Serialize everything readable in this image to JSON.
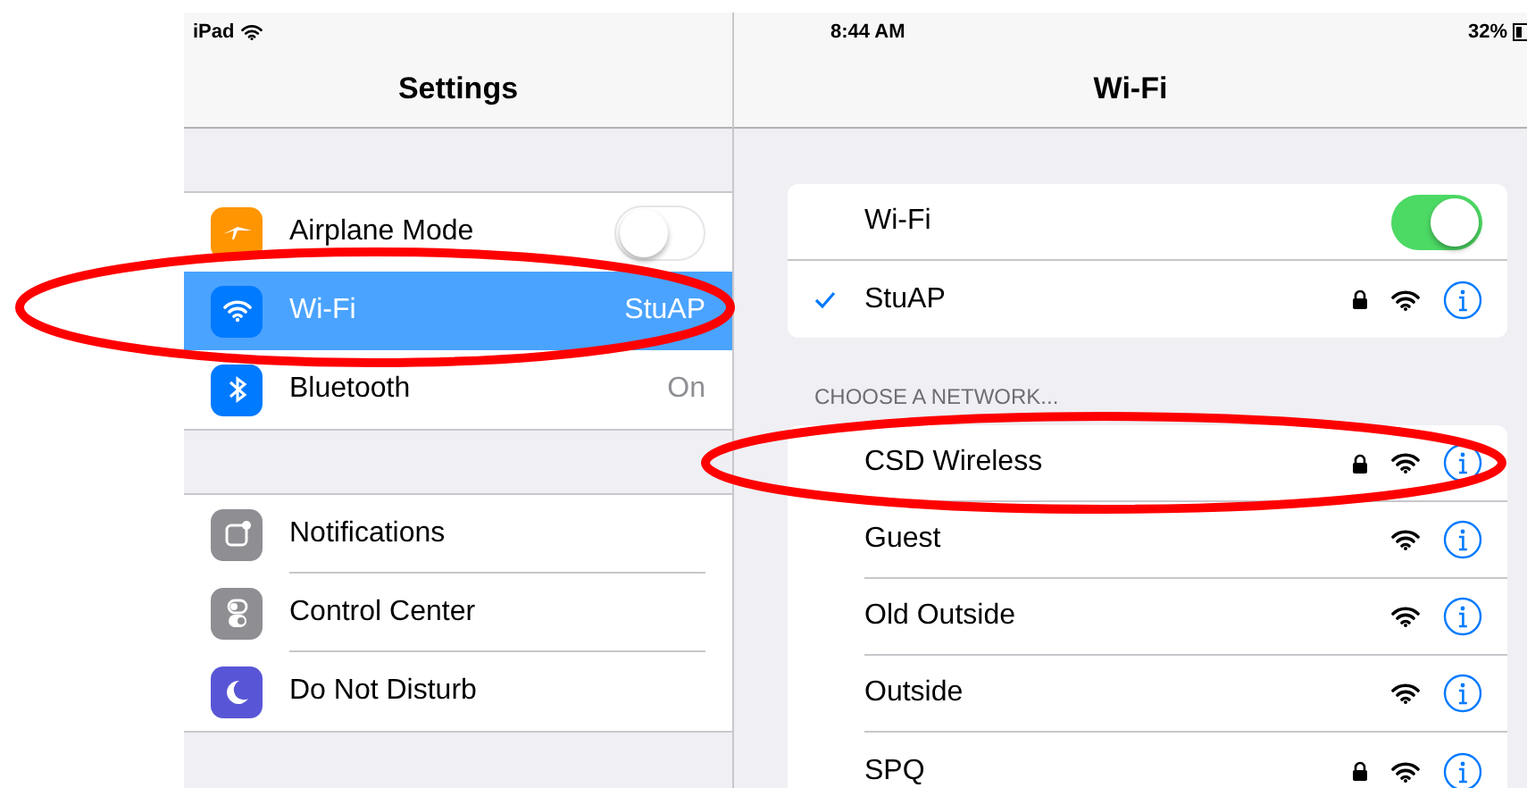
{
  "status_bar": {
    "device": "iPad",
    "time": "8:44 AM",
    "battery": "32%"
  },
  "sidebar": {
    "title": "Settings",
    "groups": [
      [
        {
          "label": "Airplane Mode",
          "kind": "toggle",
          "on": false,
          "selected": false,
          "color": "#ff9500"
        },
        {
          "label": "Wi-Fi",
          "kind": "value",
          "value": "StuAP",
          "selected": true,
          "color": "#007aff"
        },
        {
          "label": "Bluetooth",
          "kind": "value",
          "value": "On",
          "selected": false,
          "color": "#007aff"
        }
      ],
      [
        {
          "label": "Notifications",
          "kind": "plain",
          "selected": false,
          "color": "#8e8e93"
        },
        {
          "label": "Control Center",
          "kind": "plain",
          "selected": false,
          "color": "#8e8e93"
        },
        {
          "label": "Do Not Disturb",
          "kind": "plain",
          "selected": false,
          "color": "#5856d6"
        }
      ]
    ]
  },
  "detail": {
    "title": "Wi-Fi",
    "wifi": {
      "label": "Wi-Fi",
      "on": true
    },
    "current": {
      "name": "StuAP",
      "locked": true,
      "selected": true
    },
    "section_header": "CHOOSE A NETWORK...",
    "networks": [
      {
        "name": "CSD Wireless",
        "locked": true
      },
      {
        "name": "Guest",
        "locked": false
      },
      {
        "name": "Old Outside",
        "locked": false
      },
      {
        "name": "Outside",
        "locked": false
      },
      {
        "name": "SPQ",
        "locked": true
      }
    ]
  }
}
